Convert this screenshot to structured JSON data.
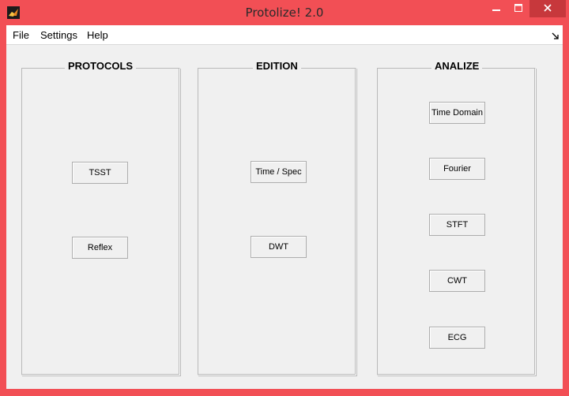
{
  "window": {
    "title": "Protolize! 2.0",
    "frame_color": "#f24f55",
    "close_color": "#c7383c"
  },
  "menu": {
    "items": [
      {
        "label": "File"
      },
      {
        "label": "Settings"
      },
      {
        "label": "Help"
      }
    ]
  },
  "panels": {
    "protocols": {
      "title": "PROTOCOLS",
      "buttons": [
        {
          "label": "TSST"
        },
        {
          "label": "Reflex"
        }
      ]
    },
    "edition": {
      "title": "EDITION",
      "buttons": [
        {
          "label": "Time / Spec"
        },
        {
          "label": "DWT"
        }
      ]
    },
    "analize": {
      "title": "ANALIZE",
      "buttons": [
        {
          "label": "Time Domain"
        },
        {
          "label": "Fourier"
        },
        {
          "label": "STFT"
        },
        {
          "label": "CWT"
        },
        {
          "label": "ECG"
        }
      ]
    }
  },
  "icons": {
    "app": "matlab-logo-icon",
    "minimize": "minimize-icon",
    "maximize": "maximize-icon",
    "close": "close-icon",
    "dock": "dock-arrow-icon"
  }
}
